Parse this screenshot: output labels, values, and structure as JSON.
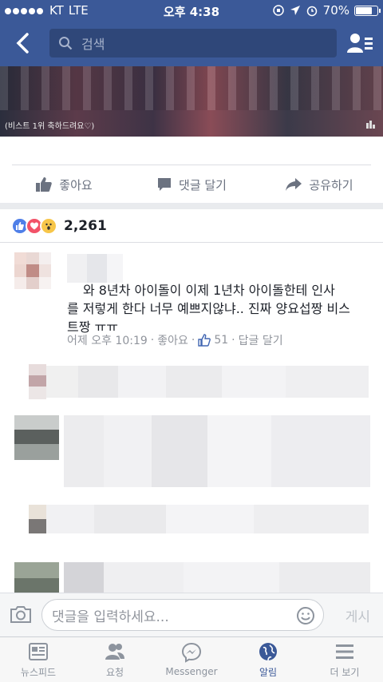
{
  "status": {
    "carrier": "KT",
    "network": "LTE",
    "time": "오후 4:38",
    "battery": "70%",
    "battery_level": 0.7
  },
  "nav": {
    "search_placeholder": "검색"
  },
  "hero": {
    "caption": "(비스트 1위 축하드려요♡)"
  },
  "actions": {
    "like": "좋아요",
    "comment": "댓글 달기",
    "share": "공유하기"
  },
  "reactions": {
    "count": "2,261",
    "types": [
      "like-icon",
      "love-icon",
      "wow-icon"
    ],
    "colors": {
      "like": "#4f7fe8",
      "love": "#f25268",
      "wow": "#f7c64a"
    }
  },
  "comment": {
    "line1": "와 8년차 아이돌이 이제 1년차 아이돌한테 인사",
    "line2": "를 저렇게 한다 너무 예쁘지않냐.. 진짜 양요섭짱 비스",
    "line3": "트짱 ㅠㅠ",
    "time": "어제 오후 10:19",
    "like_label": "좋아요",
    "likes": "51",
    "reply_label": "답글 달기"
  },
  "composer": {
    "placeholder": "댓글을 입력하세요...",
    "post_label": "게시"
  },
  "tabs": [
    {
      "label": "뉴스피드",
      "icon": "newsfeed-icon"
    },
    {
      "label": "요청",
      "icon": "friend-requests-icon"
    },
    {
      "label": "Messenger",
      "icon": "messenger-icon"
    },
    {
      "label": "알림",
      "icon": "globe-icon"
    },
    {
      "label": "더 보기",
      "icon": "menu-icon"
    }
  ],
  "colors": {
    "brand": "#3b5998",
    "active_tab": "#3b5998"
  }
}
